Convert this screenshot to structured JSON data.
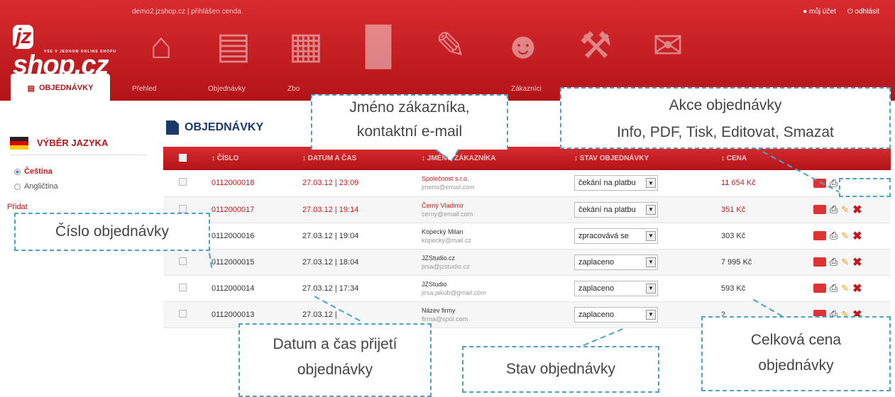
{
  "header": {
    "info": "demo2.jzshop.cz | přihlášen cenda",
    "account": "můj účet",
    "logout": "odhlásit",
    "logo": "jzshop.cz",
    "logo_sub": "VSE V JEDNOM ONLINE SHOPU"
  },
  "nav_icons": [
    "home-icon",
    "document-icon",
    "cart-icon",
    "chart-icon",
    "pencil-icon",
    "users-icon",
    "wrench-icon",
    "chat-icon"
  ],
  "tabs": {
    "active": "OBJEDNÁVKY",
    "items": [
      "Přehled",
      "Objednávky",
      "Zbo",
      "Zákazníci"
    ]
  },
  "sidebar": {
    "title": "VÝBĚR JAZYKA",
    "languages": [
      {
        "label": "Čeština",
        "selected": true
      },
      {
        "label": "Angličtina",
        "selected": false
      }
    ],
    "add": "Přidat"
  },
  "page": {
    "title": "OBJEDNÁVKY"
  },
  "table": {
    "headers": [
      "ČÍSLO",
      "DATUM A ČAS",
      "JMÉNO ZÁKAZNÍKA",
      "STAV OBJEDNÁVKY",
      "CENA"
    ],
    "rows": [
      {
        "number": "0112000018",
        "date": "27.03.12 | 23:09",
        "name": "Společnost s.r.o.",
        "email": "jmeno@email.com",
        "status": "čekání na platbu",
        "price": "11 654 Kč"
      },
      {
        "number": "0112000017",
        "date": "27.03.12 | 19:14",
        "name": "Černý Vladimír",
        "email": "cerny@email.com",
        "status": "čekání na platbu",
        "price": "351 Kč"
      },
      {
        "number": "0112000016",
        "date": "27.03.12 | 19:04",
        "name": "Kopecký Milan",
        "email": "kopecky@mail.cz",
        "status": "zpracovává se",
        "price": "303 Kč"
      },
      {
        "number": "0112000015",
        "date": "27.03.12 | 18:04",
        "name": "JZStudio.cz",
        "email": "jirsa@jzstudio.cz",
        "status": "zaplaceno",
        "price": "7 995 Kč"
      },
      {
        "number": "0112000014",
        "date": "27.03.12 | 17:34",
        "name": "JZStudio",
        "email": "jirsa.jakub@gmail.com",
        "status": "zaplaceno",
        "price": "593 Kč"
      },
      {
        "number": "0112000013",
        "date": "27.03.12 |",
        "name": "Název firmy",
        "email": "firma@spol.com",
        "status": "zaplaceno",
        "price": "2"
      }
    ]
  },
  "callouts": {
    "customer": "Jméno zákazníka,\nkontaktní e-mail",
    "actions": "Akce objednávky\nInfo, PDF, Tisk, Editovat, Smazat",
    "number": "Číslo objednávky",
    "date": "Datum a čas přijetí\nobjednávky",
    "status": "Stav objednávky",
    "price": "Celková cena\nobjednávky"
  }
}
